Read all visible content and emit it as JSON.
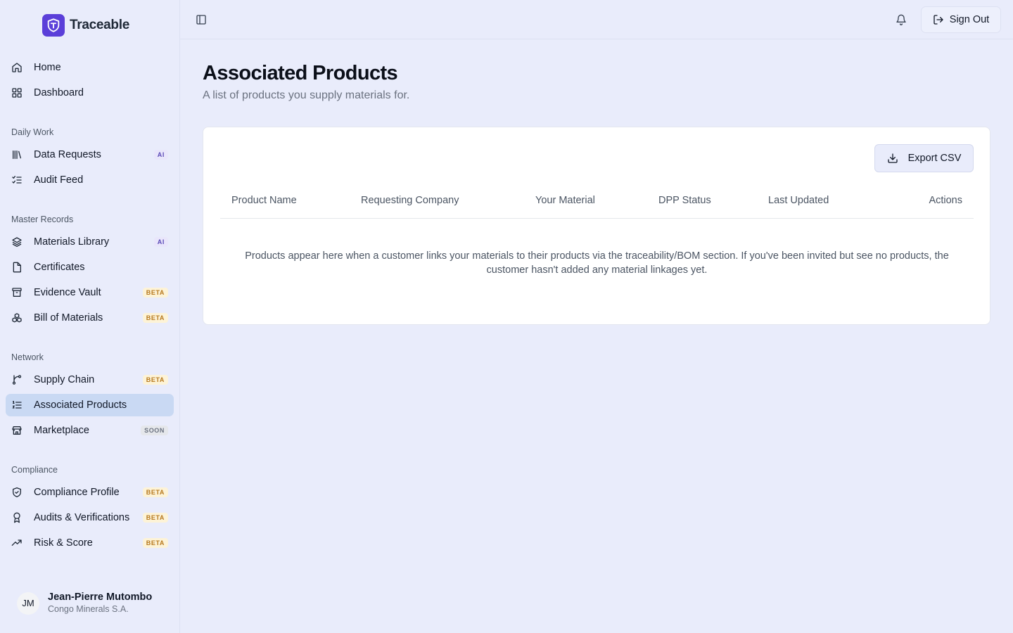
{
  "brand": {
    "name": "Traceable",
    "logo_icon": "shield-t-icon",
    "accent": "#5b3fd9"
  },
  "nav": {
    "top": [
      {
        "label": "Home",
        "icon": "home-icon"
      },
      {
        "label": "Dashboard",
        "icon": "grid-icon"
      }
    ],
    "groups": [
      {
        "title": "Daily Work",
        "items": [
          {
            "label": "Data Requests",
            "icon": "library-icon",
            "badge": "AI"
          },
          {
            "label": "Audit Feed",
            "icon": "list-checks-icon"
          }
        ]
      },
      {
        "title": "Master Records",
        "items": [
          {
            "label": "Materials Library",
            "icon": "layers-icon",
            "badge": "AI"
          },
          {
            "label": "Certificates",
            "icon": "file-icon"
          },
          {
            "label": "Evidence Vault",
            "icon": "archive-icon",
            "badge": "BETA"
          },
          {
            "label": "Bill of Materials",
            "icon": "boxes-icon",
            "badge": "BETA"
          }
        ]
      },
      {
        "title": "Network",
        "items": [
          {
            "label": "Supply Chain",
            "icon": "git-branch-icon",
            "badge": "BETA"
          },
          {
            "label": "Associated Products",
            "icon": "list-ordered-icon",
            "active": true
          },
          {
            "label": "Marketplace",
            "icon": "store-icon",
            "badge": "SOON"
          }
        ]
      },
      {
        "title": "Compliance",
        "items": [
          {
            "label": "Compliance Profile",
            "icon": "shield-check-icon",
            "badge": "BETA"
          },
          {
            "label": "Audits & Verifications",
            "icon": "award-icon",
            "badge": "BETA"
          },
          {
            "label": "Risk & Score",
            "icon": "trending-up-icon",
            "badge": "BETA"
          }
        ]
      }
    ]
  },
  "user": {
    "initials": "JM",
    "name": "Jean-Pierre Mutombo",
    "org": "Congo Minerals S.A."
  },
  "topbar": {
    "signout_label": "Sign Out"
  },
  "page": {
    "title": "Associated Products",
    "subtitle": "A list of products you supply materials for."
  },
  "table": {
    "export_label": "Export CSV",
    "columns": [
      "Product Name",
      "Requesting Company",
      "Your Material",
      "DPP Status",
      "Last Updated",
      "Actions"
    ],
    "empty_message": "Products appear here when a customer links your materials to their products via the traceability/BOM section. If you've been invited but see no products, the customer hasn't added any material linkages yet."
  }
}
